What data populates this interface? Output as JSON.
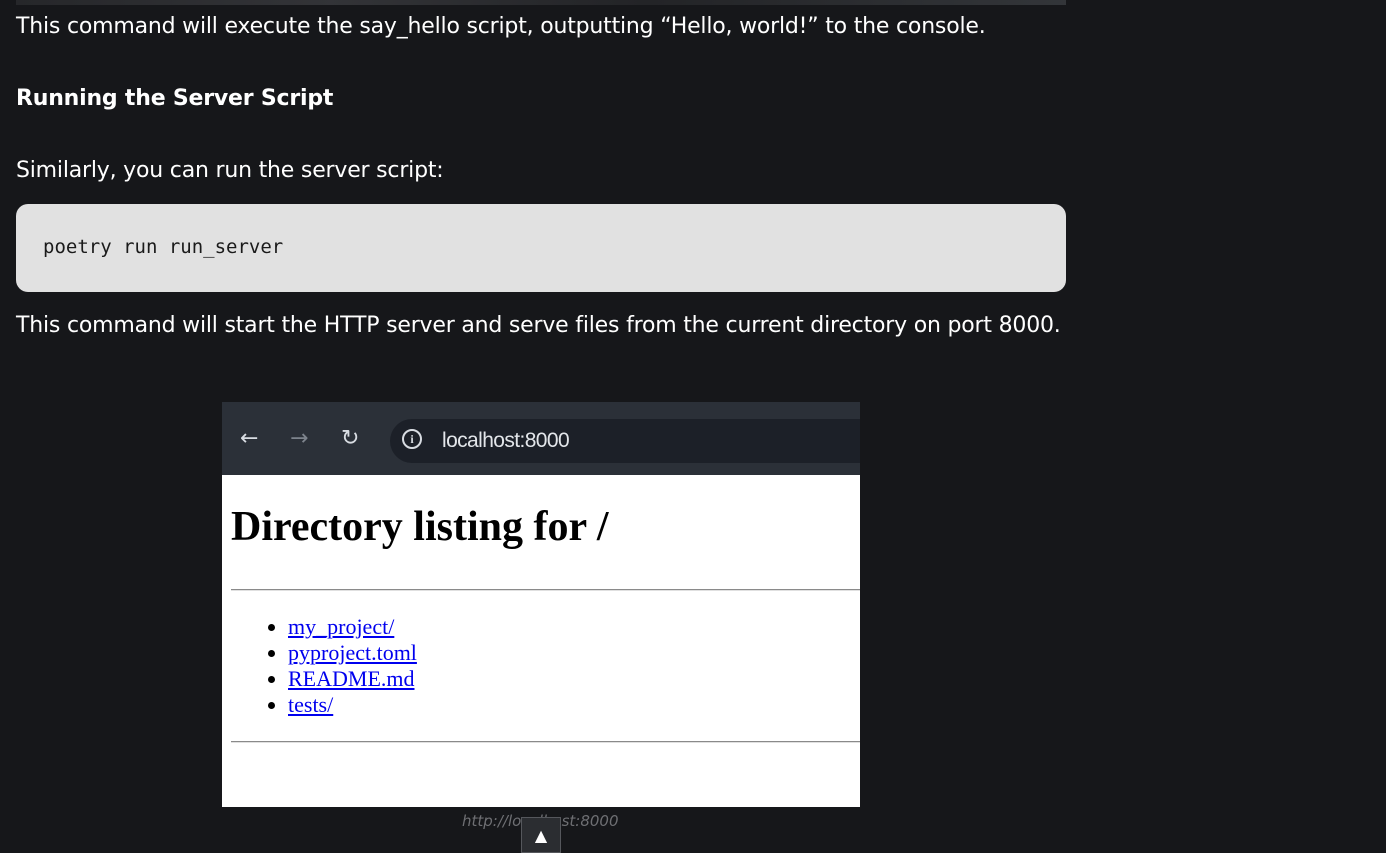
{
  "article": {
    "para_say_hello": "This command will execute the say_hello script, outputting “Hello, world!” to the console.",
    "heading_server": "Running the Server Script",
    "para_similarly": "Similarly, you can run the server script:",
    "code_run_server": "poetry run run_server",
    "para_server_desc": "This command will start the HTTP server and serve files from the current directory on port 8000."
  },
  "screenshot": {
    "url": "localhost:8000",
    "page_title": "Directory listing for /",
    "items": [
      "my_project/",
      "pyproject.toml",
      "README.md",
      "tests/"
    ],
    "icons": {
      "back": "arrow-left-icon",
      "forward": "arrow-right-icon",
      "reload": "reload-icon",
      "info": "info-icon"
    },
    "caption": "http://localhost:8000"
  },
  "back_to_top": {
    "label": "▲"
  },
  "colors": {
    "background": "#16171a",
    "code_bg": "#e1e1e1",
    "link": "#0000ee"
  }
}
